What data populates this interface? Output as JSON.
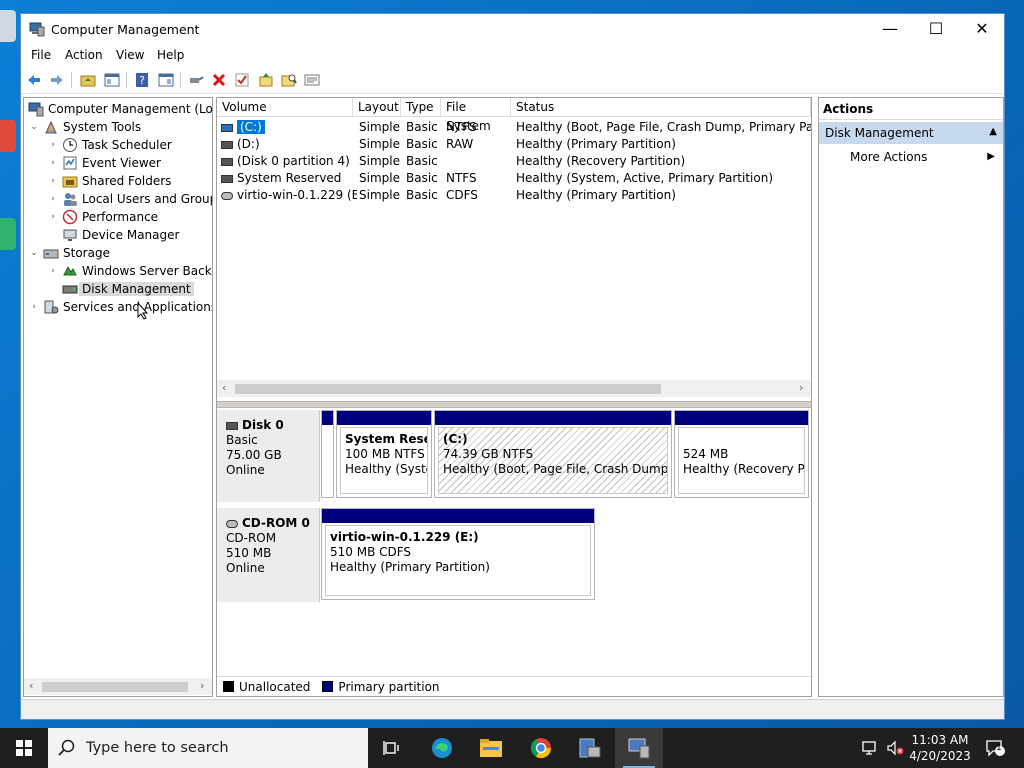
{
  "window": {
    "title": "Computer Management",
    "minimize_glyph": "—",
    "maximize_glyph": "☐",
    "close_glyph": "✕"
  },
  "menu": [
    "File",
    "Action",
    "View",
    "Help"
  ],
  "toolbar_icons": [
    "back-icon",
    "forward-icon",
    "up-folder-icon",
    "show-hide-tree-icon",
    "help-icon",
    "properties-icon",
    "connect-icon",
    "delete-icon",
    "check-icon",
    "import-icon",
    "search-icon",
    "export-list-icon"
  ],
  "tree": {
    "root": "Computer Management (Local",
    "items": [
      {
        "label": "System Tools",
        "level": 1,
        "expander": "expanded"
      },
      {
        "label": "Task Scheduler",
        "level": 2,
        "expander": "collapsed"
      },
      {
        "label": "Event Viewer",
        "level": 2,
        "expander": "collapsed"
      },
      {
        "label": "Shared Folders",
        "level": 2,
        "expander": "collapsed"
      },
      {
        "label": "Local Users and Groups",
        "level": 2,
        "expander": "collapsed"
      },
      {
        "label": "Performance",
        "level": 2,
        "expander": "collapsed"
      },
      {
        "label": "Device Manager",
        "level": 2,
        "expander": "none"
      },
      {
        "label": "Storage",
        "level": 1,
        "expander": "expanded"
      },
      {
        "label": "Windows Server Backup",
        "level": 2,
        "expander": "collapsed"
      },
      {
        "label": "Disk Management",
        "level": 2,
        "expander": "none",
        "selected": true
      },
      {
        "label": "Services and Applications",
        "level": 1,
        "expander": "collapsed"
      }
    ]
  },
  "volumes": {
    "columns": [
      "Volume",
      "Layout",
      "Type",
      "File System",
      "Status"
    ],
    "rows": [
      {
        "volume": "(C:)",
        "layout": "Simple",
        "type": "Basic",
        "fs": "NTFS",
        "status": "Healthy (Boot, Page File, Crash Dump, Primary Partition)",
        "selected": true
      },
      {
        "volume": "(D:)",
        "layout": "Simple",
        "type": "Basic",
        "fs": "RAW",
        "status": "Healthy (Primary Partition)"
      },
      {
        "volume": "(Disk 0 partition 4)",
        "layout": "Simple",
        "type": "Basic",
        "fs": "",
        "status": "Healthy (Recovery Partition)"
      },
      {
        "volume": "System Reserved",
        "layout": "Simple",
        "type": "Basic",
        "fs": "NTFS",
        "status": "Healthy (System, Active, Primary Partition)"
      },
      {
        "volume": "virtio-win-0.1.229 (E:)",
        "layout": "Simple",
        "type": "Basic",
        "fs": "CDFS",
        "status": "Healthy (Primary Partition)"
      }
    ]
  },
  "disks": [
    {
      "name": "Disk 0",
      "type": "Basic",
      "size": "75.00 GB",
      "state": "Online",
      "partitions": [
        {
          "name": "System Reserv",
          "line2": "100 MB NTFS",
          "line3": "Healthy (Systen"
        },
        {
          "name": "(C:)",
          "line2": "74.39 GB NTFS",
          "line3": "Healthy (Boot, Page File, Crash Dump, Prin"
        },
        {
          "name": "",
          "line2": "524 MB",
          "line3": "Healthy (Recovery Part"
        }
      ]
    },
    {
      "name": "CD-ROM 0",
      "type": "CD-ROM",
      "size": "510 MB",
      "state": "Online",
      "partitions": [
        {
          "name": "virtio-win-0.1.229  (E:)",
          "line2": "510 MB CDFS",
          "line3": "Healthy (Primary Partition)"
        }
      ]
    }
  ],
  "legend": [
    {
      "label": "Unallocated",
      "color": "#000000"
    },
    {
      "label": "Primary partition",
      "color": "#00007f"
    }
  ],
  "actions": {
    "header": "Actions",
    "section": "Disk Management",
    "items": [
      "More Actions"
    ]
  },
  "taskbar": {
    "search_placeholder": "Type here to search",
    "apps": [
      "task-view-icon",
      "edge-icon",
      "file-explorer-icon",
      "chrome-icon",
      "server-manager-icon",
      "computer-management-icon"
    ],
    "time": "11:03 AM",
    "date": "4/20/2023",
    "notification_count": "1"
  },
  "colors": {
    "selection": "#0078d7",
    "primary_partition": "#00007f",
    "actions_section_bg": "#c7d9ee",
    "taskbar": "#1f1f1f"
  }
}
